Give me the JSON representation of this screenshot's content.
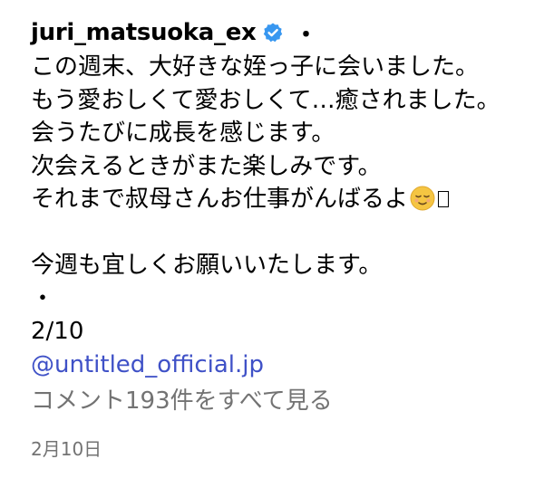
{
  "post": {
    "username": "juri_matsuoka_ex",
    "separator": "・",
    "caption_lines": [
      "この週末、大好きな姪っ子に会いました。",
      "もう愛おしくて愛おしくて…癒されました。",
      "会うたびに成長を感じます。",
      "次会えるときがまた楽しみです。",
      "それまで叔母さんお仕事がんばるよ",
      "",
      "今週も宜しくお願いいたします。",
      "・",
      "2/10"
    ],
    "emoji_icon": "relieved-face-icon",
    "mention": "@untitled_official.jp",
    "view_comments": "コメント193件をすべて見る",
    "date": "2月10日",
    "colors": {
      "verified": "#3897f0",
      "mention": "#3f51c7",
      "muted": "#737373"
    }
  }
}
